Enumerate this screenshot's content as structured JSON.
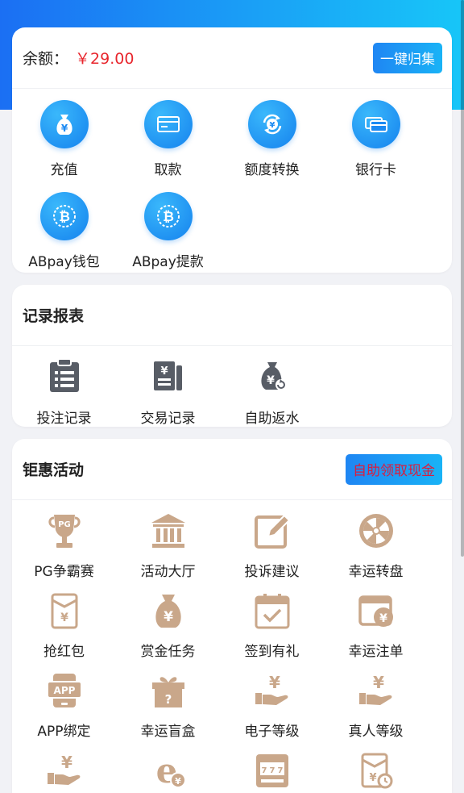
{
  "wallet": {
    "balance_label": "余额：",
    "balance_value": "￥29.00",
    "collect_button": "一键归集",
    "items": [
      {
        "label": "充值",
        "icon": "money-bag-icon"
      },
      {
        "label": "取款",
        "icon": "card-icon"
      },
      {
        "label": "额度转换",
        "icon": "exchange-icon"
      },
      {
        "label": "银行卡",
        "icon": "bank-card-icon"
      },
      {
        "label": "ABpay钱包",
        "icon": "bitcoin-icon"
      },
      {
        "label": "ABpay提款",
        "icon": "bitcoin-icon"
      }
    ]
  },
  "records": {
    "title": "记录报表",
    "items": [
      {
        "label": "投注记录",
        "icon": "clipboard-icon"
      },
      {
        "label": "交易记录",
        "icon": "ledger-icon"
      },
      {
        "label": "自助返水",
        "icon": "rebate-bag-icon"
      }
    ]
  },
  "promotions": {
    "title": "钜惠活动",
    "claim_button": "自助领取现金",
    "items": [
      {
        "label": "PG争霸赛",
        "icon": "trophy-icon"
      },
      {
        "label": "活动大厅",
        "icon": "hall-icon"
      },
      {
        "label": "投诉建议",
        "icon": "edit-icon"
      },
      {
        "label": "幸运转盘",
        "icon": "wheel-icon"
      },
      {
        "label": "抢红包",
        "icon": "red-envelope-icon"
      },
      {
        "label": "赏金任务",
        "icon": "money-bag-icon"
      },
      {
        "label": "签到有礼",
        "icon": "calendar-check-icon"
      },
      {
        "label": "幸运注单",
        "icon": "wallet-yen-icon"
      },
      {
        "label": "APP绑定",
        "icon": "app-icon"
      },
      {
        "label": "幸运盲盒",
        "icon": "mystery-box-icon"
      },
      {
        "label": "电子等级",
        "icon": "hand-yen-icon"
      },
      {
        "label": "真人等级",
        "icon": "hand-yen-icon"
      },
      {
        "label": "",
        "icon": "hand-yen-icon"
      },
      {
        "label": "",
        "icon": "ie-yen-icon"
      },
      {
        "label": "",
        "icon": "slot-machine-icon"
      },
      {
        "label": "",
        "icon": "envelope-clock-icon"
      }
    ]
  },
  "colors": {
    "accent": "#1b8af3",
    "icon_tan": "#c9a78a",
    "icon_gray": "#585d66",
    "amount_red": "#e8262d"
  }
}
